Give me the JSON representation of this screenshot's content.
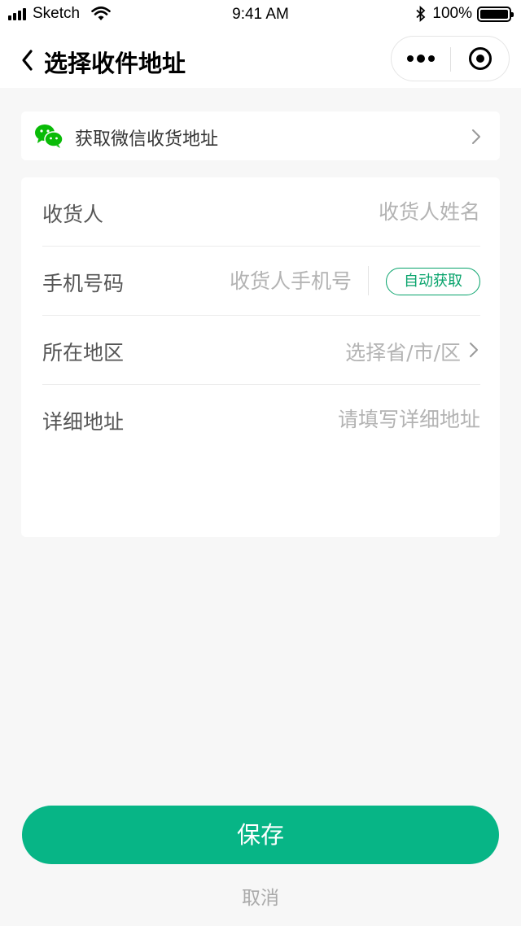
{
  "status_bar": {
    "carrier": "Sketch",
    "time": "9:41 AM",
    "battery": "100%"
  },
  "nav": {
    "title": "选择收件地址"
  },
  "wechat_address": {
    "label": "获取微信收货地址",
    "icon": "wechat-icon"
  },
  "form": {
    "recipient": {
      "label": "收货人",
      "placeholder": "收货人姓名",
      "value": ""
    },
    "phone": {
      "label": "手机号码",
      "placeholder": "收货人手机号",
      "value": "",
      "auto_fill_label": "自动获取"
    },
    "region": {
      "label": "所在地区",
      "placeholder": "选择省/市/区"
    },
    "address": {
      "label": "详细地址",
      "placeholder": "请填写详细地址",
      "value": ""
    }
  },
  "actions": {
    "save_label": "保存",
    "cancel_label": "取消"
  },
  "colors": {
    "accent": "#07b586",
    "accent_text": "#07a36b",
    "background": "#f7f7f7"
  }
}
